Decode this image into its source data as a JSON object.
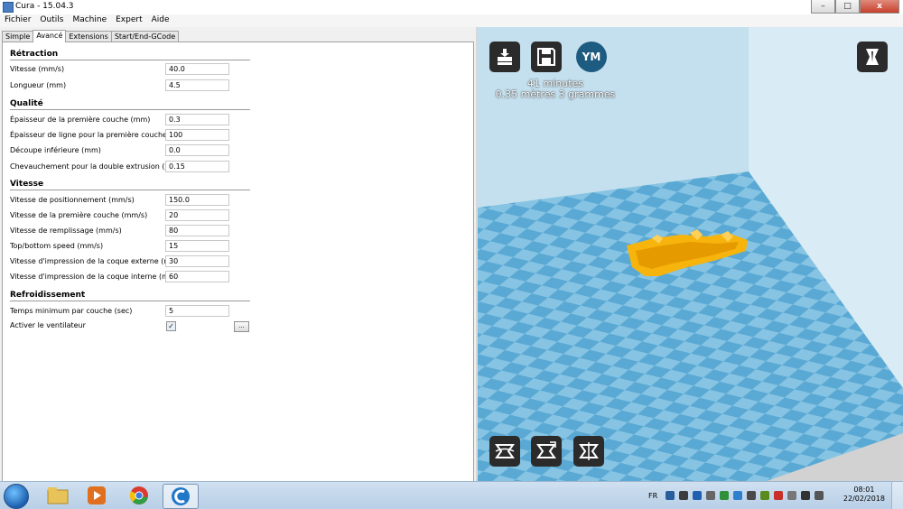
{
  "window": {
    "title": "Cura - 15.04.3",
    "controls": {
      "minimize": "–",
      "maximize": "□",
      "close": "x"
    }
  },
  "menu": [
    "Fichier",
    "Outils",
    "Machine",
    "Expert",
    "Aide"
  ],
  "tabs": [
    {
      "label": "Simple",
      "active": false
    },
    {
      "label": "Avancé",
      "active": true
    },
    {
      "label": "Extensions",
      "active": false
    },
    {
      "label": "Start/End-GCode",
      "active": false
    }
  ],
  "sections": {
    "retraction": {
      "title": "Rétraction",
      "rows": [
        {
          "label": "Vitesse (mm/s)",
          "value": "40.0"
        },
        {
          "label": "Longueur (mm)",
          "value": "4.5"
        }
      ]
    },
    "qualite": {
      "title": "Qualité",
      "rows": [
        {
          "label": "Épaisseur de la première couche (mm)",
          "value": "0.3"
        },
        {
          "label": "Épaisseur de ligne pour la première couche (%)",
          "value": "100"
        },
        {
          "label": "Découpe inférieure (mm)",
          "value": "0.0"
        },
        {
          "label": "Chevauchement pour la double extrusion (mm)",
          "value": "0.15"
        }
      ]
    },
    "vitesse": {
      "title": "Vitesse",
      "rows": [
        {
          "label": "Vitesse de positionnement (mm/s)",
          "value": "150.0"
        },
        {
          "label": "Vitesse de la première couche (mm/s)",
          "value": "20"
        },
        {
          "label": "Vitesse de remplissage (mm/s)",
          "value": "80"
        },
        {
          "label": "Top/bottom speed (mm/s)",
          "value": "15"
        },
        {
          "label": "Vitesse d'impression de la coque externe (mm/s)",
          "value": "30"
        },
        {
          "label": "Vitesse d'impression de la coque interne (mm/s)",
          "value": "60"
        }
      ]
    },
    "refroidissement": {
      "title": "Refroidissement",
      "rows": [
        {
          "label": "Temps minimum par couche (sec)",
          "value": "5"
        }
      ],
      "fan": {
        "label": "Activer le ventilateur",
        "checked": true,
        "mark": "✓",
        "options_button": "..."
      }
    }
  },
  "viewport": {
    "top_icons": [
      "load-model-icon",
      "save-gcode-icon",
      "youmagine-icon"
    ],
    "youmagine_label": "YM",
    "print_time": "41 minutes",
    "print_material": "0.35 mètres 3 grammes",
    "view_mode_icon": "view-mode-icon",
    "bottom_icons": [
      "rotate-icon",
      "scale-icon",
      "mirror-icon"
    ],
    "colors": {
      "wall": "#c4e0ef",
      "floor_light": "#87c4e3",
      "floor_dark": "#5aa9d4",
      "model": "#f7b40c"
    }
  },
  "taskbar": {
    "language": "FR",
    "time": "08:01",
    "date": "22/02/2018",
    "apps": [
      "windows-explorer-icon",
      "media-player-icon",
      "chrome-icon",
      "cura-icon"
    ]
  }
}
